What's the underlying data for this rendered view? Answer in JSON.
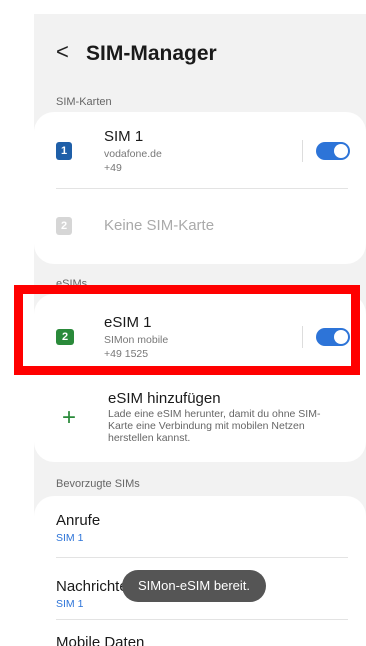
{
  "header": {
    "back_symbol": "<",
    "title": "SIM-Manager"
  },
  "sim_cards": {
    "section_label": "SIM-Karten",
    "sim1": {
      "badge": "1",
      "name": "SIM 1",
      "operator": "vodafone.de",
      "number": "+49",
      "enabled": true
    },
    "sim2": {
      "badge": "2",
      "name": "Keine SIM-Karte"
    }
  },
  "esims": {
    "section_label": "eSIMs",
    "esim1": {
      "badge": "2",
      "name": "eSIM 1",
      "operator": "SIMon mobile",
      "number": "+49 1525",
      "enabled": true
    },
    "add": {
      "title": "eSIM hinzufügen",
      "description": "Lade eine eSIM herunter, damit du ohne SIM-Karte eine Verbindung mit mobilen Netzen herstellen kannst."
    }
  },
  "preferred": {
    "section_label": "Bevorzugte SIMs",
    "items": [
      {
        "label": "Anrufe",
        "value": "SIM 1"
      },
      {
        "label": "Nachrichten",
        "value": "SIM 1"
      },
      {
        "label": "Mobile Daten",
        "value": ""
      }
    ]
  },
  "toast": {
    "text": "SIMon-eSIM bereit."
  },
  "colors": {
    "accent": "#2d74d8",
    "highlight": "#ff0000",
    "esim_green": "#2a8a3a"
  }
}
